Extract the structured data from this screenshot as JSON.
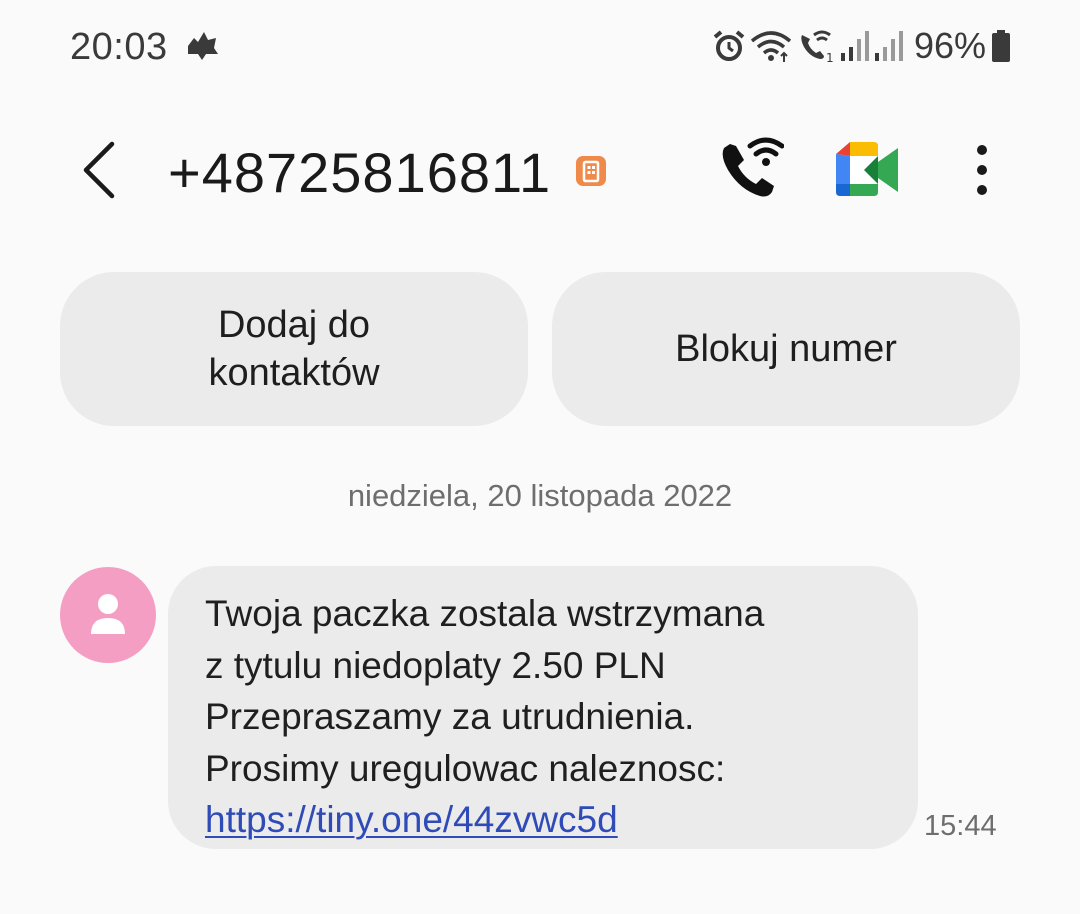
{
  "status_bar": {
    "time": "20:03",
    "battery_percent": "96%",
    "icons": [
      "notification-icon",
      "alarm-icon",
      "wifi-icon",
      "wifi-calling-icon",
      "signal-icon",
      "signal-icon",
      "battery-icon"
    ]
  },
  "header": {
    "contact_number": "+48725816811",
    "icons": [
      "back-arrow-icon",
      "sim-badge-icon",
      "wifi-call-icon",
      "video-call-icon",
      "more-vert-icon"
    ]
  },
  "actions": {
    "add_contact_line1": "Dodaj do",
    "add_contact_line2": "kontaktów",
    "block_number": "Blokuj numer"
  },
  "conversation": {
    "date": "niedziela, 20 listopada 2022",
    "message": {
      "lines": [
        "Twoja paczka zostala wstrzymana",
        "z tytulu niedoplaty 2.50 PLN",
        "Przepraszamy za utrudnienia.",
        "Prosimy uregulowac naleznosc:"
      ],
      "link": "https://tiny.one/44zvwc5d",
      "time": "15:44"
    }
  },
  "colors": {
    "background": "#fafafa",
    "bubble": "#ebebeb",
    "avatar": "#f39ec2",
    "link": "#2f4bb8",
    "sim_badge": "#f08a4b"
  }
}
